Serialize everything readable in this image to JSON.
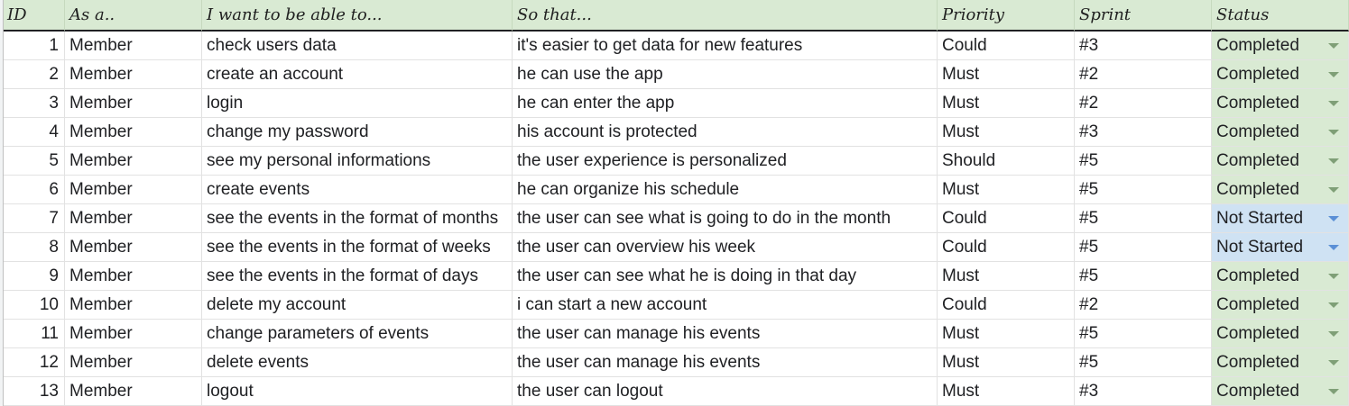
{
  "columns": {
    "id": "ID",
    "as": "As a..",
    "want": "I want to be able to...",
    "so": "So that...",
    "priority": "Priority",
    "sprint": "Sprint",
    "status": "Status"
  },
  "rows": [
    {
      "id": "1",
      "as": "Member",
      "want": "check users data",
      "so": "it's easier to get data for new features",
      "priority": "Could",
      "sprint": "#3",
      "status": "Completed"
    },
    {
      "id": "2",
      "as": "Member",
      "want": "create an account",
      "so": "he can use the app",
      "priority": "Must",
      "sprint": "#2",
      "status": "Completed"
    },
    {
      "id": "3",
      "as": "Member",
      "want": "login",
      "so": "he can enter the app",
      "priority": "Must",
      "sprint": "#2",
      "status": "Completed"
    },
    {
      "id": "4",
      "as": "Member",
      "want": "change my password",
      "so": "his account is protected",
      "priority": "Must",
      "sprint": "#3",
      "status": "Completed"
    },
    {
      "id": "5",
      "as": "Member",
      "want": "see my personal informations",
      "so": "the user experience is personalized",
      "priority": "Should",
      "sprint": "#5",
      "status": "Completed"
    },
    {
      "id": "6",
      "as": "Member",
      "want": "create events",
      "so": "he can organize his schedule",
      "priority": "Must",
      "sprint": "#5",
      "status": "Completed"
    },
    {
      "id": "7",
      "as": "Member",
      "want": "see the events in the format of months",
      "so": "the user can see what is going to do in the month",
      "priority": "Could",
      "sprint": "#5",
      "status": "Not Started"
    },
    {
      "id": "8",
      "as": "Member",
      "want": "see the events in the format of weeks",
      "so": "the user can overview his week",
      "priority": "Could",
      "sprint": "#5",
      "status": "Not Started"
    },
    {
      "id": "9",
      "as": "Member",
      "want": "see the events in the format of days",
      "so": "the user can see what he is doing in that day",
      "priority": "Must",
      "sprint": "#5",
      "status": "Completed"
    },
    {
      "id": "10",
      "as": "Member",
      "want": "delete my account",
      "so": "i can start a new account",
      "priority": "Could",
      "sprint": "#2",
      "status": "Completed"
    },
    {
      "id": "11",
      "as": "Member",
      "want": "change parameters of events",
      "so": "the user can manage his events",
      "priority": "Must",
      "sprint": "#5",
      "status": "Completed"
    },
    {
      "id": "12",
      "as": "Member",
      "want": "delete events",
      "so": "the user can manage his events",
      "priority": "Must",
      "sprint": "#5",
      "status": "Completed"
    },
    {
      "id": "13",
      "as": "Member",
      "want": "logout",
      "so": "the user can logout",
      "priority": "Must",
      "sprint": "#3",
      "status": "Completed"
    }
  ],
  "colors": {
    "header_bg": "#d9ead3",
    "completed_bg": "#d9ead3",
    "not_started_bg": "#cfe2f3"
  },
  "icons": {
    "status_dropdown": "chevron-down-icon"
  }
}
